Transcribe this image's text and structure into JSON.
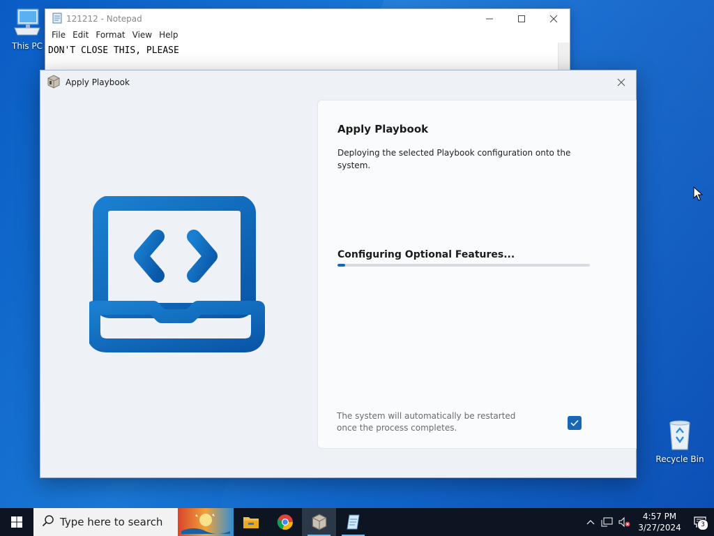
{
  "desktop": {
    "icons": [
      {
        "label": "This PC",
        "icon": "this-pc-icon"
      },
      {
        "label": "Recycle Bin",
        "icon": "recycle-bin-icon"
      }
    ]
  },
  "notepad": {
    "title": "121212 - Notepad",
    "menu": [
      "File",
      "Edit",
      "Format",
      "View",
      "Help"
    ],
    "content": "DON'T CLOSE THIS, PLEASE"
  },
  "dialog": {
    "title": "Apply Playbook",
    "heading": "Apply Playbook",
    "description": "Deploying the selected Playbook configuration onto the system.",
    "status": "Configuring Optional Features...",
    "progress_fraction": 0.03,
    "restart_note": "The system will automatically be restarted once the process completes.",
    "restart_checked": true,
    "accent_color": "#1767b8"
  },
  "taskbar": {
    "search_placeholder": "Type here to search",
    "apps": [
      "file-explorer-icon",
      "chrome-icon",
      "playbook-app-icon",
      "notepad-icon"
    ],
    "time": "4:57 PM",
    "date": "3/27/2024",
    "notification_count": "3"
  }
}
